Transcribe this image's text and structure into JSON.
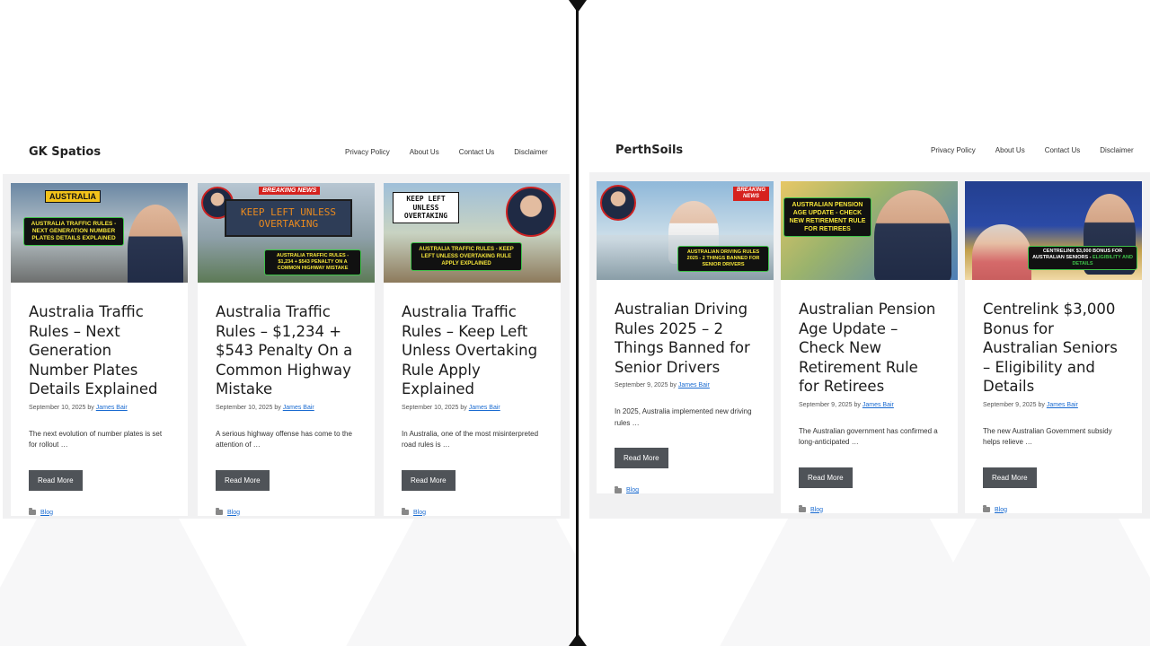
{
  "left": {
    "site_title": "GK Spatios",
    "nav": [
      "Privacy Policy",
      "About Us",
      "Contact Us",
      "Disclaimer"
    ],
    "posts": [
      {
        "title": "Australia Traffic Rules – Next Generation Number Plates Details Explained",
        "date": "September 10, 2025",
        "by": "by",
        "author": "James Bair",
        "excerpt": "The next evolution of number plates is set for rollout …",
        "read_more": "Read More",
        "category": "Blog",
        "image_sign": "AUSTRALIA",
        "image_banner": "AUSTRALIA TRAFFIC RULES - NEXT GENERATION NUMBER PLATES DETAILS EXPLAINED"
      },
      {
        "title": "Australia Traffic Rules – $1,234 + $543 Penalty On a Common Highway Mistake",
        "date": "September 10, 2025",
        "by": "by",
        "author": "James Bair",
        "excerpt": "A serious highway offense has come to the attention of …",
        "read_more": "Read More",
        "category": "Blog",
        "image_badge": "BREAKING NEWS",
        "image_sign": "KEEP LEFT UNLESS OVERTAKING",
        "image_banner": "AUSTRALIA TRAFFIC RULES - $1,234 + $543 PENALTY ON A COMMON HIGHWAY MISTAKE"
      },
      {
        "title": "Australia Traffic Rules – Keep Left Unless Overtaking Rule Apply Explained",
        "date": "September 10, 2025",
        "by": "by",
        "author": "James Bair",
        "excerpt": "In Australia, one of the most misinterpreted road rules is …",
        "read_more": "Read More",
        "category": "Blog",
        "image_sign": "KEEP LEFT UNLESS OVERTAKING",
        "image_banner": "AUSTRALIA TRAFFIC RULES - KEEP LEFT UNLESS OVERTAKING RULE APPLY EXPLAINED"
      }
    ]
  },
  "right": {
    "site_title": "PerthSoils",
    "nav": [
      "Privacy Policy",
      "About Us",
      "Contact Us",
      "Disclaimer"
    ],
    "posts": [
      {
        "title": "Australian Driving Rules 2025 – 2 Things Banned for Senior Drivers",
        "date": "September 9, 2025",
        "by": "by",
        "author": "James Bair",
        "excerpt": "In 2025, Australia implemented new driving rules …",
        "read_more": "Read More",
        "category": "Blog",
        "image_badge": "BREAKING NEWS",
        "image_banner": "AUSTRALIAN DRIVING RULES 2025 - 2 THINGS BANNED FOR SENIOR DRIVERS"
      },
      {
        "title": "Australian Pension Age Update – Check New Retirement Rule for Retirees",
        "date": "September 9, 2025",
        "by": "by",
        "author": "James Bair",
        "excerpt": "The Australian government has confirmed a long-anticipated …",
        "read_more": "Read More",
        "category": "Blog",
        "image_banner": "AUSTRALIAN PENSION AGE UPDATE - CHECK NEW RETIREMENT RULE FOR RETIREES"
      },
      {
        "title": "Centrelink $3,000 Bonus for Australian Seniors – Eligibility and Details",
        "date": "September 9, 2025",
        "by": "by",
        "author": "James Bair",
        "excerpt": "The new Australian Government subsidy helps relieve …",
        "read_more": "Read More",
        "category": "Blog",
        "image_banner_white": "CENTRELINK $3,000 BONUS FOR AUSTRALIAN SENIORS -",
        "image_banner_green": "ELIGIBILITY AND DETAILS"
      }
    ]
  }
}
